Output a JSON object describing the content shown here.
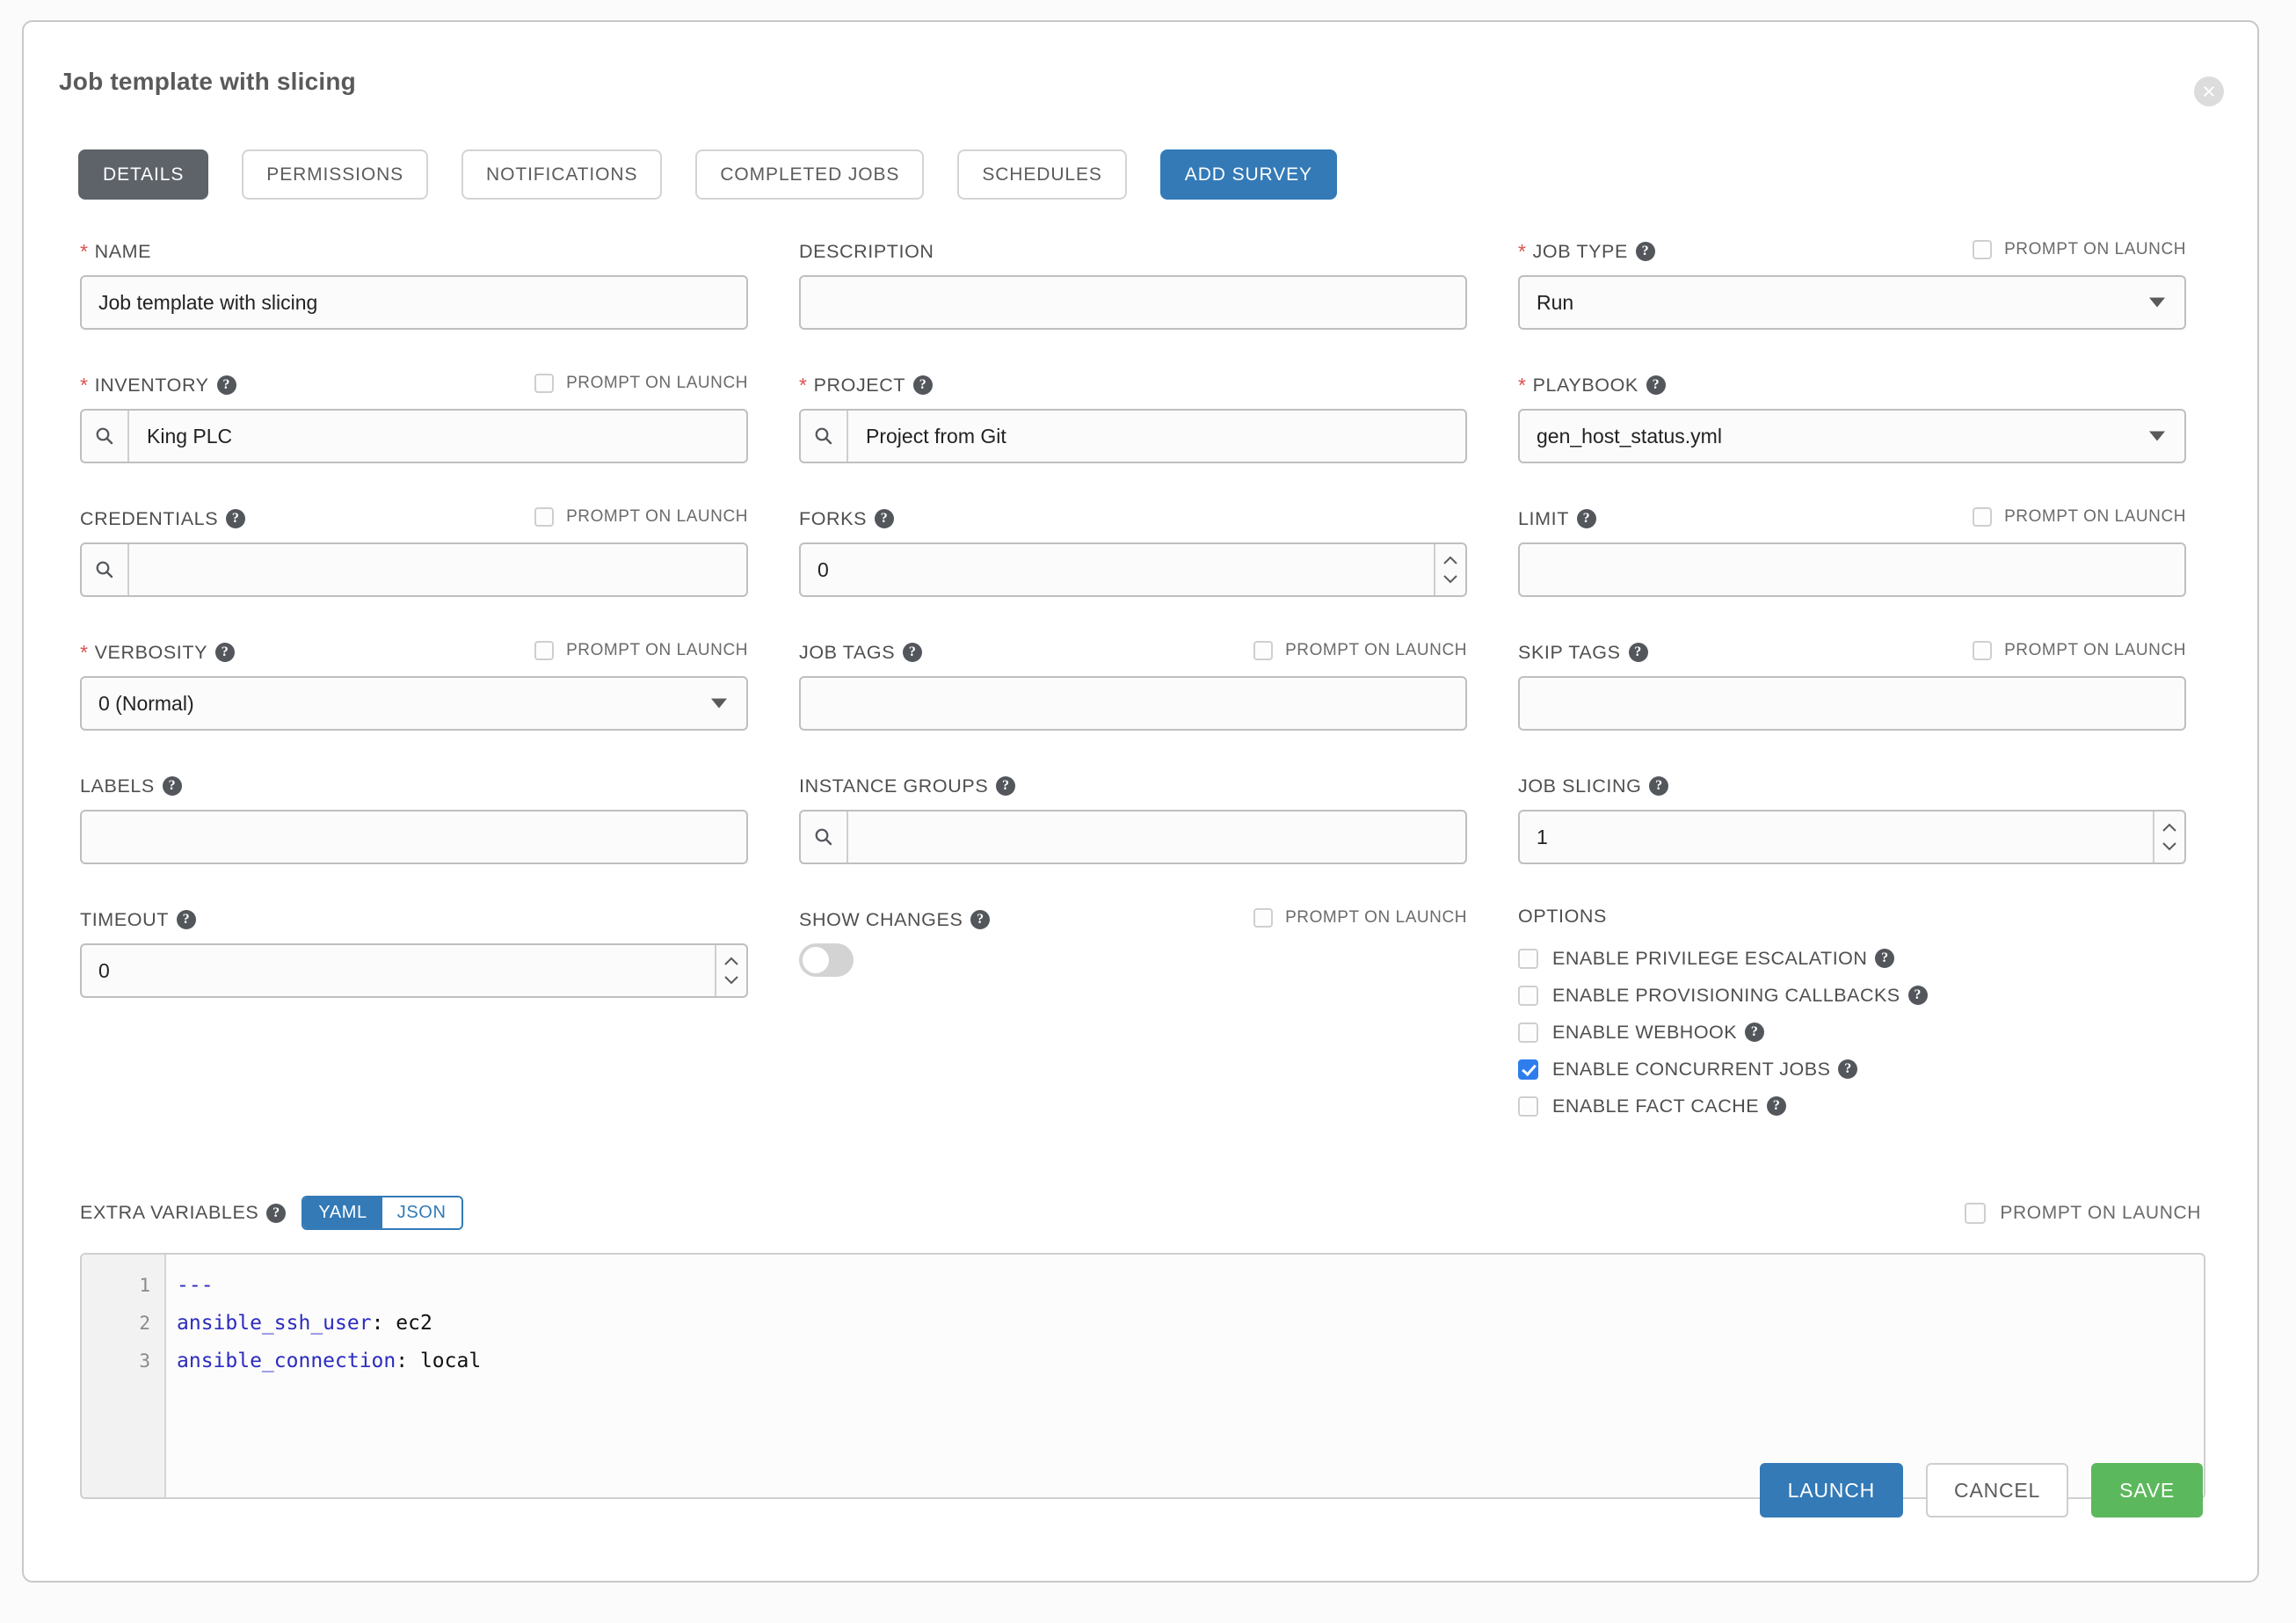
{
  "window": {
    "title": "Job template with slicing",
    "close_icon": "close-circle-icon"
  },
  "tabs": [
    {
      "label": "DETAILS",
      "state": "active"
    },
    {
      "label": "PERMISSIONS",
      "state": "default"
    },
    {
      "label": "NOTIFICATIONS",
      "state": "default"
    },
    {
      "label": "COMPLETED JOBS",
      "state": "default"
    },
    {
      "label": "SCHEDULES",
      "state": "default"
    },
    {
      "label": "ADD SURVEY",
      "state": "primary"
    }
  ],
  "common": {
    "prompt_on_launch": "PROMPT ON LAUNCH",
    "help_icon": "help-circle-icon",
    "search_icon": "search-icon"
  },
  "fields": {
    "name": {
      "label": "NAME",
      "required": true,
      "value": "Job template with slicing"
    },
    "description": {
      "label": "DESCRIPTION",
      "required": false,
      "value": ""
    },
    "job_type": {
      "label": "JOB TYPE",
      "required": true,
      "value": "Run"
    },
    "inventory": {
      "label": "INVENTORY",
      "required": true,
      "value": "King PLC"
    },
    "project": {
      "label": "PROJECT",
      "required": true,
      "value": "Project from Git"
    },
    "playbook": {
      "label": "PLAYBOOK",
      "required": true,
      "value": "gen_host_status.yml"
    },
    "credentials": {
      "label": "CREDENTIALS",
      "required": false,
      "value": ""
    },
    "forks": {
      "label": "FORKS",
      "required": false,
      "value": "0"
    },
    "limit": {
      "label": "LIMIT",
      "required": false,
      "value": ""
    },
    "verbosity": {
      "label": "VERBOSITY",
      "required": true,
      "value": "0 (Normal)"
    },
    "job_tags": {
      "label": "JOB TAGS",
      "required": false,
      "value": ""
    },
    "skip_tags": {
      "label": "SKIP TAGS",
      "required": false,
      "value": ""
    },
    "labels": {
      "label": "LABELS",
      "required": false,
      "value": ""
    },
    "instance_groups": {
      "label": "INSTANCE GROUPS",
      "required": false,
      "value": ""
    },
    "job_slicing": {
      "label": "JOB SLICING",
      "required": false,
      "value": "1"
    },
    "timeout": {
      "label": "TIMEOUT",
      "required": false,
      "value": "0"
    },
    "show_changes": {
      "label": "SHOW CHANGES",
      "required": false,
      "value": "off"
    }
  },
  "options": {
    "title": "OPTIONS",
    "items": [
      {
        "label": "ENABLE PRIVILEGE ESCALATION",
        "checked": false
      },
      {
        "label": "ENABLE PROVISIONING CALLBACKS",
        "checked": false
      },
      {
        "label": "ENABLE WEBHOOK",
        "checked": false
      },
      {
        "label": "ENABLE CONCURRENT JOBS",
        "checked": true
      },
      {
        "label": "ENABLE FACT CACHE",
        "checked": false
      }
    ]
  },
  "extra_variables": {
    "label": "EXTRA VARIABLES",
    "format_yaml": "YAML",
    "format_json": "JSON",
    "selected_format": "YAML",
    "prompt_on_launch": "PROMPT ON LAUNCH",
    "lines": [
      {
        "no": "1",
        "key": "---",
        "sep": "",
        "value": ""
      },
      {
        "no": "2",
        "key": "ansible_ssh_user",
        "sep": ": ",
        "value": "ec2"
      },
      {
        "no": "3",
        "key": "ansible_connection",
        "sep": ": ",
        "value": "local"
      }
    ]
  },
  "footer": {
    "launch": "LAUNCH",
    "cancel": "CANCEL",
    "save": "SAVE"
  },
  "colors": {
    "primary": "#337ab7",
    "success": "#5cb85c",
    "active_tab": "#5e6269",
    "required": "#d9534f",
    "checkbox_checked": "#2f7ded"
  }
}
